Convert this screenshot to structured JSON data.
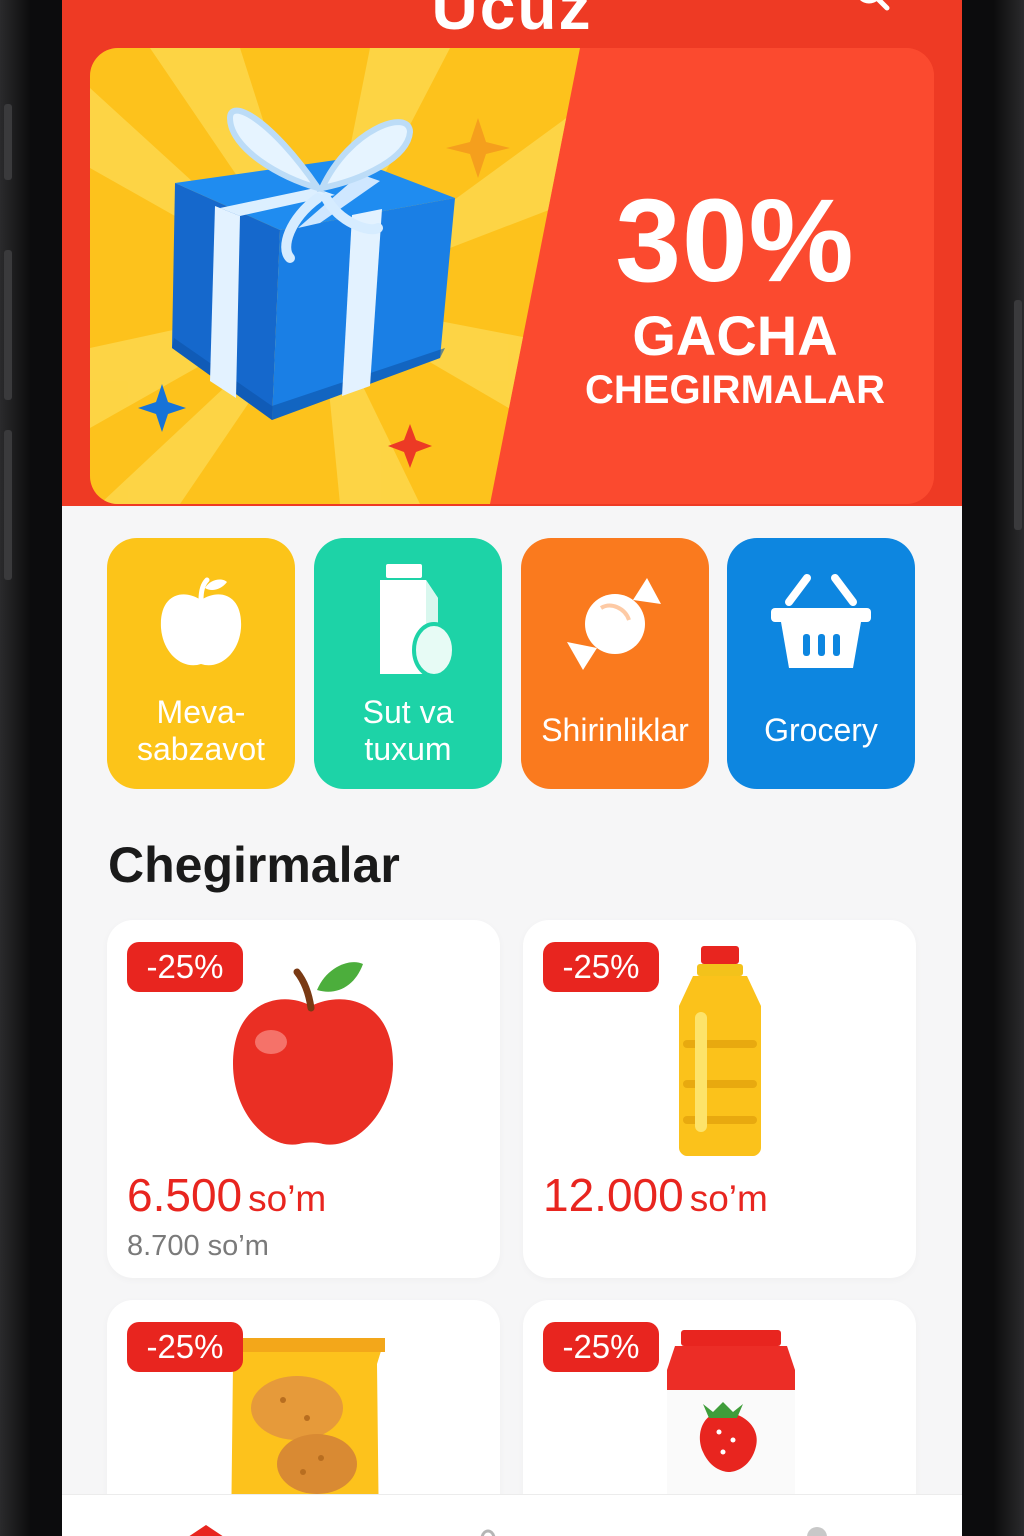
{
  "app": {
    "title": "Ucuz"
  },
  "banner": {
    "percent": "30%",
    "line1": "GACHA",
    "line2": "CHEGIRMALAR"
  },
  "categories": [
    {
      "label": "Meva-\nsabzavot",
      "color": "#fcc419",
      "icon": "apple-icon"
    },
    {
      "label": "Sut va\ntuxum",
      "color": "#1dd3a7",
      "icon": "milk-egg-icon"
    },
    {
      "label": "Shirinliklar",
      "color": "#fa7a1e",
      "icon": "candy-icon"
    },
    {
      "label": "Grocery",
      "color": "#0d86e0",
      "icon": "basket-icon"
    }
  ],
  "discounts": {
    "title": "Chegirmalar",
    "products": [
      {
        "badge": "-25%",
        "price": "6.500",
        "currency": "so’m",
        "old_price": "8.700 so’m",
        "icon": "red-apple-icon"
      },
      {
        "badge": "-25%",
        "price": "12.000",
        "currency": "so’m",
        "old_price": "",
        "icon": "oil-bottle-icon"
      },
      {
        "badge": "-25%",
        "price": "",
        "currency": "",
        "old_price": "",
        "icon": "chips-bag-icon"
      },
      {
        "badge": "-25%",
        "price": "",
        "currency": "",
        "old_price": "",
        "icon": "strawberry-yogurt-icon"
      }
    ]
  },
  "colors": {
    "primary": "#ee3a24",
    "badge": "#e8251f",
    "background": "#f6f6f7"
  }
}
